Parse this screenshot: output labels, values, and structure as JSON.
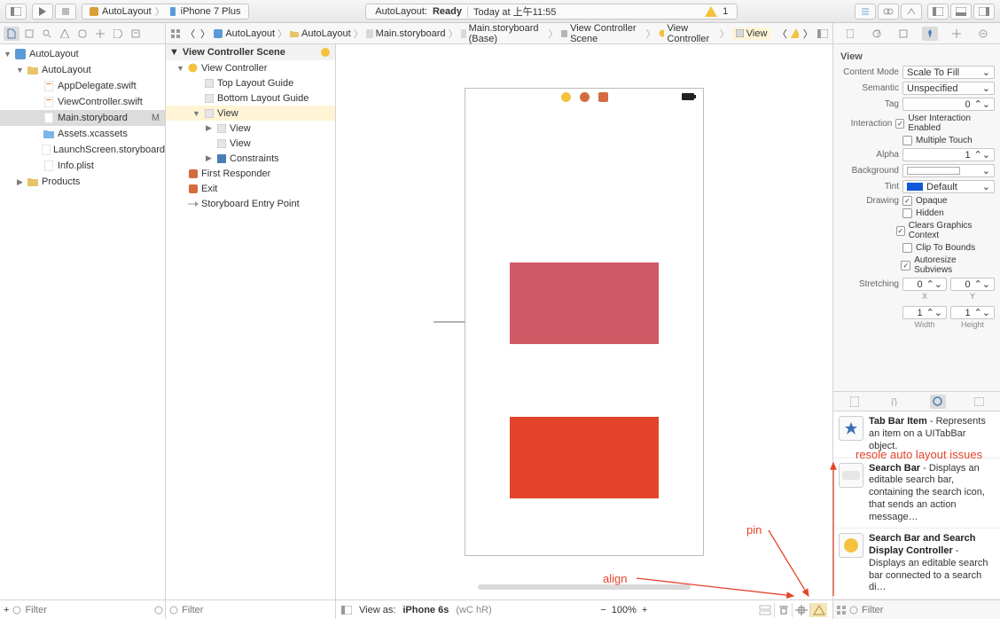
{
  "toolbar": {
    "scheme": "AutoLayout",
    "device": "iPhone 7 Plus",
    "status_title": "AutoLayout:",
    "status_state": "Ready",
    "status_time": "Today at 上午11:55",
    "warn_count": "1"
  },
  "nav_tree": {
    "root": "AutoLayout",
    "folder": "AutoLayout",
    "files": {
      "appdelegate": "AppDelegate.swift",
      "viewcontroller": "ViewController.swift",
      "storyboard": "Main.storyboard",
      "storyboard_mod": "M",
      "assets": "Assets.xcassets",
      "launch": "LaunchScreen.storyboard",
      "info": "Info.plist"
    },
    "products": "Products",
    "filter_placeholder": "Filter"
  },
  "jumpbar": {
    "b0": "AutoLayout",
    "b1": "AutoLayout",
    "b2": "Main.storyboard",
    "b3": "Main.storyboard (Base)",
    "b4": "View Controller Scene",
    "b5": "View Controller",
    "b6": "View"
  },
  "outline": {
    "header": "View Controller Scene",
    "vc": "View Controller",
    "top_guide": "Top Layout Guide",
    "bottom_guide": "Bottom Layout Guide",
    "view": "View",
    "view1": "View",
    "view2": "View",
    "constraints": "Constraints",
    "first_responder": "First Responder",
    "exit": "Exit",
    "entry": "Storyboard Entry Point",
    "filter_placeholder": "Filter"
  },
  "canvas": {
    "view_as_label": "View as:",
    "view_as_value": "iPhone 6s",
    "sizeclass": "(wC hR)",
    "zoom": "100%"
  },
  "inspector": {
    "section": "View",
    "content_mode_label": "Content Mode",
    "content_mode": "Scale To Fill",
    "semantic_label": "Semantic",
    "semantic": "Unspecified",
    "tag_label": "Tag",
    "tag": "0",
    "interaction_label": "Interaction",
    "uie": "User Interaction Enabled",
    "mt": "Multiple Touch",
    "alpha_label": "Alpha",
    "alpha": "1",
    "bg_label": "Background",
    "tint_label": "Tint",
    "tint": "Default",
    "drawing_label": "Drawing",
    "opaque": "Opaque",
    "hidden": "Hidden",
    "clears": "Clears Graphics Context",
    "clip": "Clip To Bounds",
    "autoresize": "Autoresize Subviews",
    "stretching_label": "Stretching",
    "sx": "0",
    "sy": "0",
    "sw": "1",
    "sh": "1",
    "x_label": "X",
    "y_label": "Y",
    "w_label": "Width",
    "h_label": "Height"
  },
  "library": {
    "item1_title": "Tab Bar Item",
    "item1_desc": " - Represents an item on a UITabBar object.",
    "item2_title": "Search Bar",
    "item2_desc": " - Displays an editable search bar, containing the search icon, that sends an action message…",
    "item3_title": "Search Bar and Search Display Controller",
    "item3_desc": " - Displays an editable search bar connected to a search di…",
    "filter_placeholder": "Filter"
  },
  "annotations": {
    "align": "align",
    "pin": "pin",
    "resolve": "resole auto layout issues"
  }
}
